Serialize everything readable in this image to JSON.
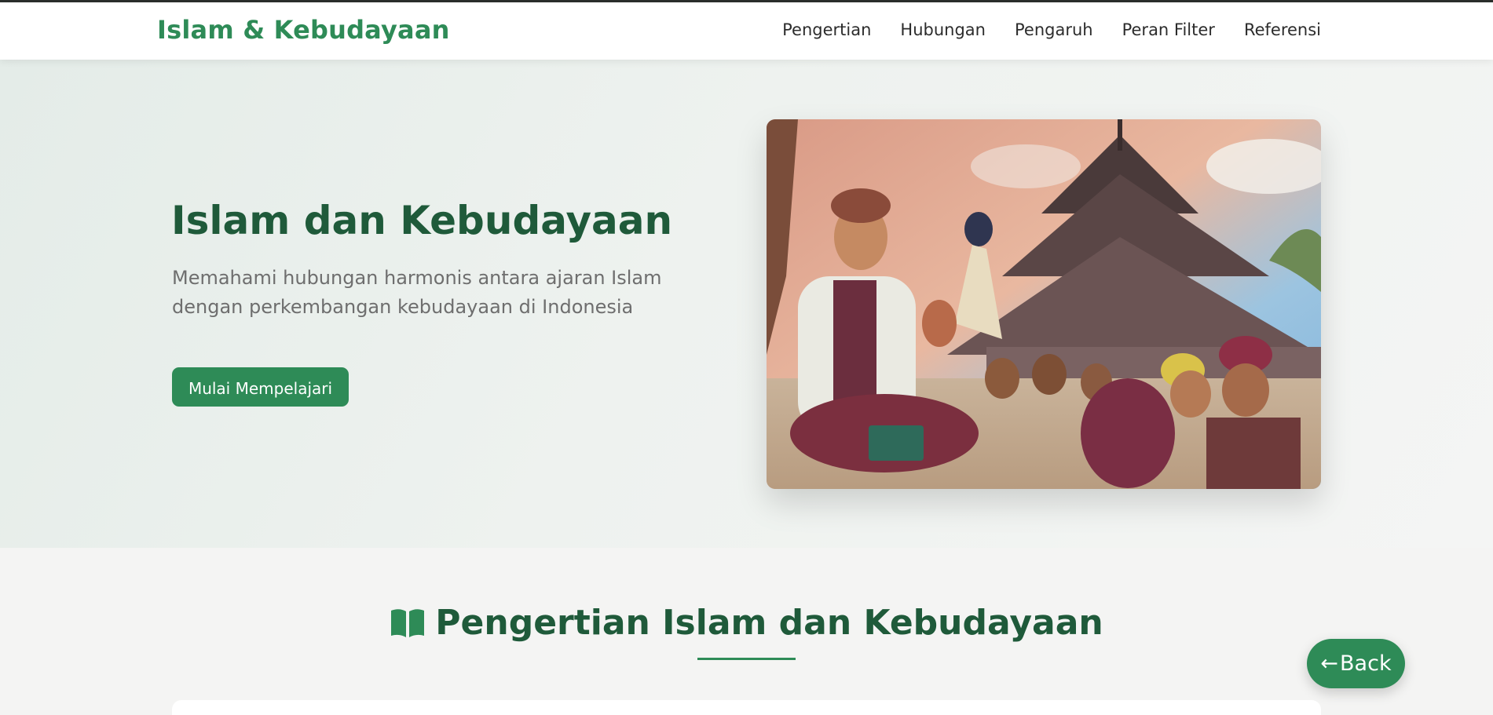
{
  "header": {
    "brand": "Islam & Kebudayaan",
    "nav": [
      "Pengertian",
      "Hubungan",
      "Pengaruh",
      "Peran Filter",
      "Referensi"
    ]
  },
  "hero": {
    "title": "Islam dan Kebudayaan",
    "subtitle": "Memahami hubungan harmonis antara ajaran Islam dengan perkembangan kebudayaan di Indonesia",
    "cta_label": "Mulai Mempelajari",
    "image_icon": "illustration-wali-wayang-mosque"
  },
  "section": {
    "icon": "open-book-icon",
    "title": "Pengertian Islam dan Kebudayaan"
  },
  "back_button": {
    "icon": "arrow-left-icon",
    "label": "Back"
  },
  "colors": {
    "accent": "#2e8b57",
    "heading": "#1f5a3a",
    "muted_text": "#6e6e6e"
  }
}
